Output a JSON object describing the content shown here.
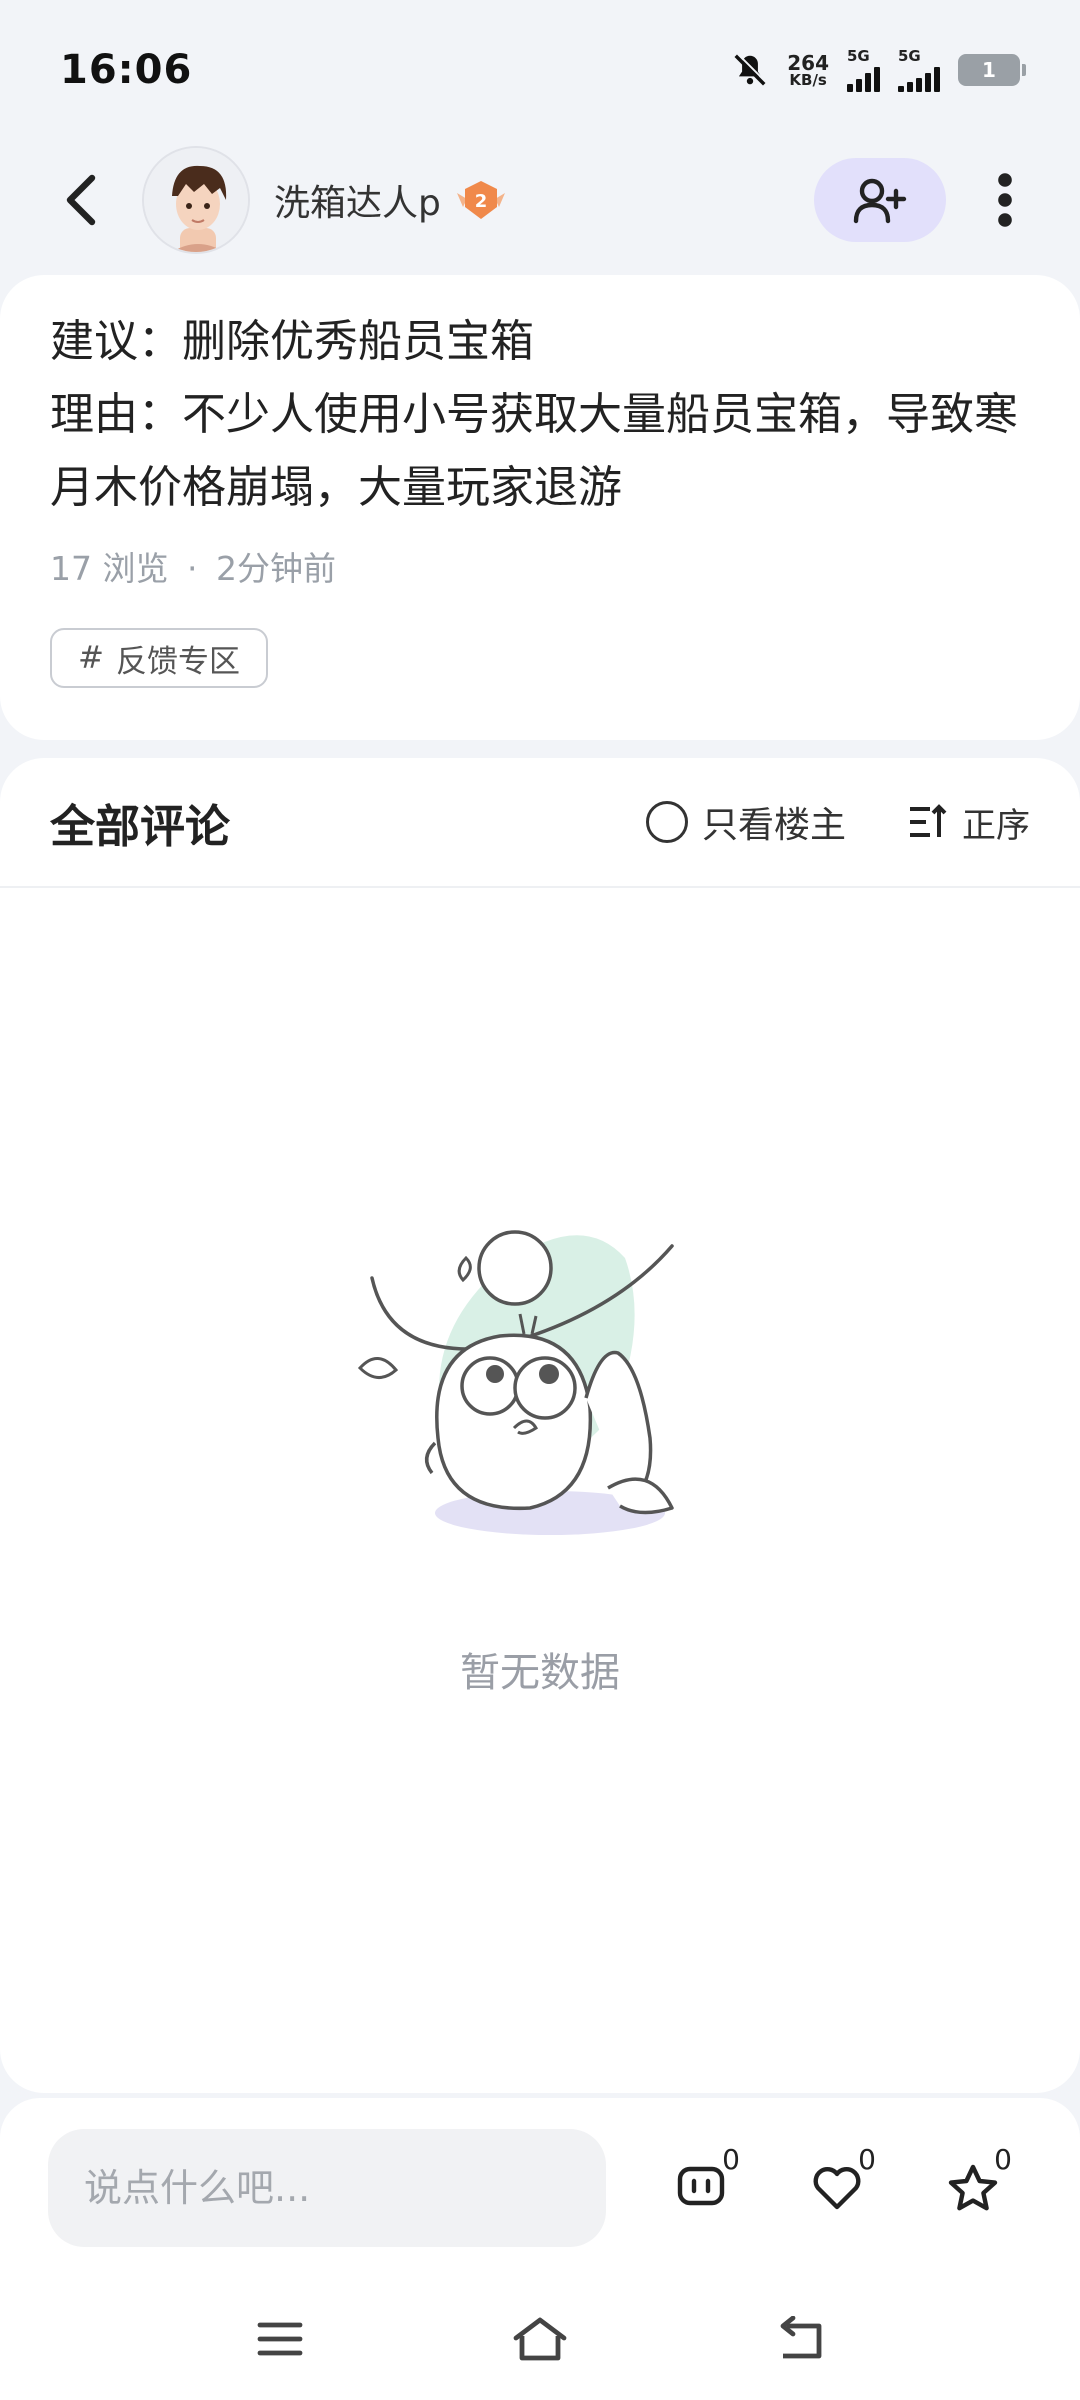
{
  "status_bar": {
    "time": "16:06",
    "net_speed": "264",
    "net_speed_unit": "KB/s",
    "signal1_label": "5G",
    "signal2_label": "5G",
    "battery": "1"
  },
  "header": {
    "username": "洗箱达人p",
    "level": "2"
  },
  "post": {
    "content": "建议：删除优秀船员宝箱\n理由：不少人使用小号获取大量船员宝箱，导致寒月木价格崩塌，大量玩家退游",
    "views": "17 浏览",
    "separator": "·",
    "time_ago": "2分钟前",
    "tag": "反馈专区"
  },
  "comments": {
    "title": "全部评论",
    "only_host_label": "只看楼主",
    "sort_label": "正序",
    "empty_text": "暂无数据"
  },
  "bottom_bar": {
    "input_placeholder": "说点什么吧...",
    "comment_count": "0",
    "like_count": "0",
    "favorite_count": "0"
  },
  "colors": {
    "accent_bg": "#e2e0fb",
    "badge": "#f0894b",
    "illustration_green": "#d9f0e6",
    "illustration_purple": "#e3e1f5"
  }
}
